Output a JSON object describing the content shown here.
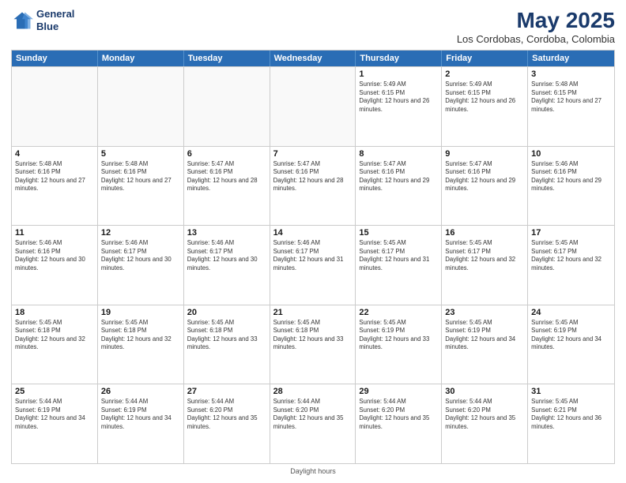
{
  "header": {
    "logo_line1": "General",
    "logo_line2": "Blue",
    "title": "May 2025",
    "subtitle": "Los Cordobas, Cordoba, Colombia"
  },
  "days_of_week": [
    "Sunday",
    "Monday",
    "Tuesday",
    "Wednesday",
    "Thursday",
    "Friday",
    "Saturday"
  ],
  "weeks": [
    [
      {
        "day": "",
        "empty": true
      },
      {
        "day": "",
        "empty": true
      },
      {
        "day": "",
        "empty": true
      },
      {
        "day": "",
        "empty": true
      },
      {
        "day": "1",
        "sunrise": "5:49 AM",
        "sunset": "6:15 PM",
        "daylight": "12 hours and 26 minutes."
      },
      {
        "day": "2",
        "sunrise": "5:49 AM",
        "sunset": "6:15 PM",
        "daylight": "12 hours and 26 minutes."
      },
      {
        "day": "3",
        "sunrise": "5:48 AM",
        "sunset": "6:15 PM",
        "daylight": "12 hours and 27 minutes."
      }
    ],
    [
      {
        "day": "4",
        "sunrise": "5:48 AM",
        "sunset": "6:16 PM",
        "daylight": "12 hours and 27 minutes."
      },
      {
        "day": "5",
        "sunrise": "5:48 AM",
        "sunset": "6:16 PM",
        "daylight": "12 hours and 27 minutes."
      },
      {
        "day": "6",
        "sunrise": "5:47 AM",
        "sunset": "6:16 PM",
        "daylight": "12 hours and 28 minutes."
      },
      {
        "day": "7",
        "sunrise": "5:47 AM",
        "sunset": "6:16 PM",
        "daylight": "12 hours and 28 minutes."
      },
      {
        "day": "8",
        "sunrise": "5:47 AM",
        "sunset": "6:16 PM",
        "daylight": "12 hours and 29 minutes."
      },
      {
        "day": "9",
        "sunrise": "5:47 AM",
        "sunset": "6:16 PM",
        "daylight": "12 hours and 29 minutes."
      },
      {
        "day": "10",
        "sunrise": "5:46 AM",
        "sunset": "6:16 PM",
        "daylight": "12 hours and 29 minutes."
      }
    ],
    [
      {
        "day": "11",
        "sunrise": "5:46 AM",
        "sunset": "6:16 PM",
        "daylight": "12 hours and 30 minutes."
      },
      {
        "day": "12",
        "sunrise": "5:46 AM",
        "sunset": "6:17 PM",
        "daylight": "12 hours and 30 minutes."
      },
      {
        "day": "13",
        "sunrise": "5:46 AM",
        "sunset": "6:17 PM",
        "daylight": "12 hours and 30 minutes."
      },
      {
        "day": "14",
        "sunrise": "5:46 AM",
        "sunset": "6:17 PM",
        "daylight": "12 hours and 31 minutes."
      },
      {
        "day": "15",
        "sunrise": "5:45 AM",
        "sunset": "6:17 PM",
        "daylight": "12 hours and 31 minutes."
      },
      {
        "day": "16",
        "sunrise": "5:45 AM",
        "sunset": "6:17 PM",
        "daylight": "12 hours and 32 minutes."
      },
      {
        "day": "17",
        "sunrise": "5:45 AM",
        "sunset": "6:17 PM",
        "daylight": "12 hours and 32 minutes."
      }
    ],
    [
      {
        "day": "18",
        "sunrise": "5:45 AM",
        "sunset": "6:18 PM",
        "daylight": "12 hours and 32 minutes."
      },
      {
        "day": "19",
        "sunrise": "5:45 AM",
        "sunset": "6:18 PM",
        "daylight": "12 hours and 32 minutes."
      },
      {
        "day": "20",
        "sunrise": "5:45 AM",
        "sunset": "6:18 PM",
        "daylight": "12 hours and 33 minutes."
      },
      {
        "day": "21",
        "sunrise": "5:45 AM",
        "sunset": "6:18 PM",
        "daylight": "12 hours and 33 minutes."
      },
      {
        "day": "22",
        "sunrise": "5:45 AM",
        "sunset": "6:19 PM",
        "daylight": "12 hours and 33 minutes."
      },
      {
        "day": "23",
        "sunrise": "5:45 AM",
        "sunset": "6:19 PM",
        "daylight": "12 hours and 34 minutes."
      },
      {
        "day": "24",
        "sunrise": "5:45 AM",
        "sunset": "6:19 PM",
        "daylight": "12 hours and 34 minutes."
      }
    ],
    [
      {
        "day": "25",
        "sunrise": "5:44 AM",
        "sunset": "6:19 PM",
        "daylight": "12 hours and 34 minutes."
      },
      {
        "day": "26",
        "sunrise": "5:44 AM",
        "sunset": "6:19 PM",
        "daylight": "12 hours and 34 minutes."
      },
      {
        "day": "27",
        "sunrise": "5:44 AM",
        "sunset": "6:20 PM",
        "daylight": "12 hours and 35 minutes."
      },
      {
        "day": "28",
        "sunrise": "5:44 AM",
        "sunset": "6:20 PM",
        "daylight": "12 hours and 35 minutes."
      },
      {
        "day": "29",
        "sunrise": "5:44 AM",
        "sunset": "6:20 PM",
        "daylight": "12 hours and 35 minutes."
      },
      {
        "day": "30",
        "sunrise": "5:44 AM",
        "sunset": "6:20 PM",
        "daylight": "12 hours and 35 minutes."
      },
      {
        "day": "31",
        "sunrise": "5:45 AM",
        "sunset": "6:21 PM",
        "daylight": "12 hours and 36 minutes."
      }
    ]
  ],
  "footer": "Daylight hours"
}
